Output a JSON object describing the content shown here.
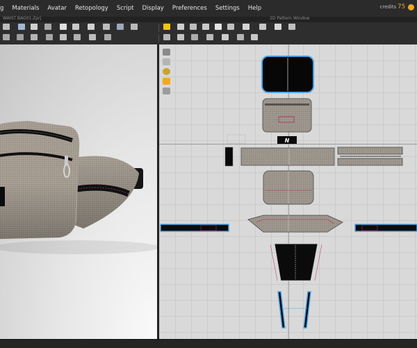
{
  "menu": {
    "items": [
      "g",
      "Materials",
      "Avatar",
      "Retopology",
      "Script",
      "Display",
      "Preferences",
      "Settings",
      "Help"
    ]
  },
  "credits": {
    "label": "credits",
    "value": "75"
  },
  "project": {
    "file_title": "WAIST BAG01.Zprj"
  },
  "pattern_window": {
    "title": "2D Pattern Window",
    "logo_text": "N"
  },
  "colors": {
    "accent": "#f3a81e",
    "selection_outline": "#4aa3e8",
    "fabric": "#9c958c",
    "webbing": "#0c0c0c"
  }
}
